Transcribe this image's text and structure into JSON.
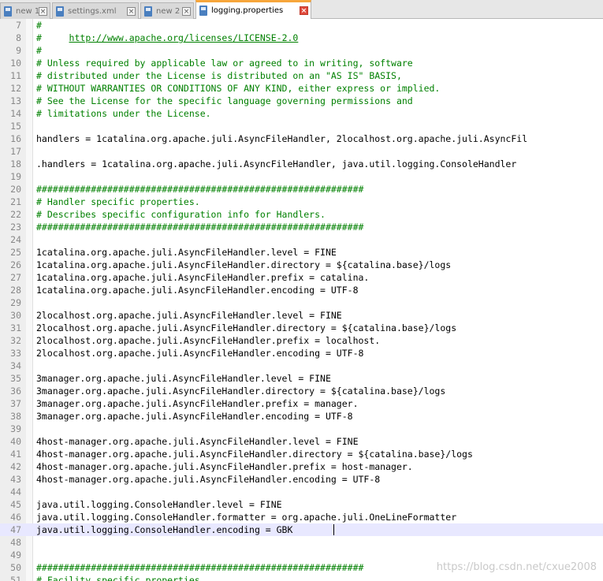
{
  "tabs": [
    {
      "label": "new 1",
      "active": false
    },
    {
      "label": "settings.xml",
      "active": false
    },
    {
      "label": "new 2",
      "active": false
    },
    {
      "label": "logging.properties",
      "active": true
    }
  ],
  "tab_close_glyph": "×",
  "lines": [
    {
      "num": "7",
      "text": "#",
      "type": "comment"
    },
    {
      "num": "8",
      "text": "#     ",
      "url": "http://www.apache.org/licenses/LICENSE-2.0",
      "type": "comment"
    },
    {
      "num": "9",
      "text": "#",
      "type": "comment"
    },
    {
      "num": "10",
      "text": "# Unless required by applicable law or agreed to in writing, software",
      "type": "comment"
    },
    {
      "num": "11",
      "text": "# distributed under the License is distributed on an \"AS IS\" BASIS,",
      "type": "comment"
    },
    {
      "num": "12",
      "text": "# WITHOUT WARRANTIES OR CONDITIONS OF ANY KIND, either express or implied.",
      "type": "comment"
    },
    {
      "num": "13",
      "text": "# See the License for the specific language governing permissions and",
      "type": "comment"
    },
    {
      "num": "14",
      "text": "# limitations under the License.",
      "type": "comment"
    },
    {
      "num": "15",
      "text": "",
      "type": "code"
    },
    {
      "num": "16",
      "text": "handlers = 1catalina.org.apache.juli.AsyncFileHandler, 2localhost.org.apache.juli.AsyncFil",
      "type": "code"
    },
    {
      "num": "17",
      "text": "",
      "type": "code"
    },
    {
      "num": "18",
      "text": ".handlers = 1catalina.org.apache.juli.AsyncFileHandler, java.util.logging.ConsoleHandler",
      "type": "code"
    },
    {
      "num": "19",
      "text": "",
      "type": "code"
    },
    {
      "num": "20",
      "text": "############################################################",
      "type": "comment"
    },
    {
      "num": "21",
      "text": "# Handler specific properties.",
      "type": "comment"
    },
    {
      "num": "22",
      "text": "# Describes specific configuration info for Handlers.",
      "type": "comment"
    },
    {
      "num": "23",
      "text": "############################################################",
      "type": "comment"
    },
    {
      "num": "24",
      "text": "",
      "type": "code"
    },
    {
      "num": "25",
      "text": "1catalina.org.apache.juli.AsyncFileHandler.level = FINE",
      "type": "code"
    },
    {
      "num": "26",
      "text": "1catalina.org.apache.juli.AsyncFileHandler.directory = ${catalina.base}/logs",
      "type": "code"
    },
    {
      "num": "27",
      "text": "1catalina.org.apache.juli.AsyncFileHandler.prefix = catalina.",
      "type": "code"
    },
    {
      "num": "28",
      "text": "1catalina.org.apache.juli.AsyncFileHandler.encoding = UTF-8",
      "type": "code"
    },
    {
      "num": "29",
      "text": "",
      "type": "code"
    },
    {
      "num": "30",
      "text": "2localhost.org.apache.juli.AsyncFileHandler.level = FINE",
      "type": "code"
    },
    {
      "num": "31",
      "text": "2localhost.org.apache.juli.AsyncFileHandler.directory = ${catalina.base}/logs",
      "type": "code"
    },
    {
      "num": "32",
      "text": "2localhost.org.apache.juli.AsyncFileHandler.prefix = localhost.",
      "type": "code"
    },
    {
      "num": "33",
      "text": "2localhost.org.apache.juli.AsyncFileHandler.encoding = UTF-8",
      "type": "code"
    },
    {
      "num": "34",
      "text": "",
      "type": "code"
    },
    {
      "num": "35",
      "text": "3manager.org.apache.juli.AsyncFileHandler.level = FINE",
      "type": "code"
    },
    {
      "num": "36",
      "text": "3manager.org.apache.juli.AsyncFileHandler.directory = ${catalina.base}/logs",
      "type": "code"
    },
    {
      "num": "37",
      "text": "3manager.org.apache.juli.AsyncFileHandler.prefix = manager.",
      "type": "code"
    },
    {
      "num": "38",
      "text": "3manager.org.apache.juli.AsyncFileHandler.encoding = UTF-8",
      "type": "code"
    },
    {
      "num": "39",
      "text": "",
      "type": "code"
    },
    {
      "num": "40",
      "text": "4host-manager.org.apache.juli.AsyncFileHandler.level = FINE",
      "type": "code"
    },
    {
      "num": "41",
      "text": "4host-manager.org.apache.juli.AsyncFileHandler.directory = ${catalina.base}/logs",
      "type": "code"
    },
    {
      "num": "42",
      "text": "4host-manager.org.apache.juli.AsyncFileHandler.prefix = host-manager.",
      "type": "code"
    },
    {
      "num": "43",
      "text": "4host-manager.org.apache.juli.AsyncFileHandler.encoding = UTF-8",
      "type": "code"
    },
    {
      "num": "44",
      "text": "",
      "type": "code"
    },
    {
      "num": "45",
      "text": "java.util.logging.ConsoleHandler.level = FINE",
      "type": "code"
    },
    {
      "num": "46",
      "text": "java.util.logging.ConsoleHandler.formatter = org.apache.juli.OneLineFormatter",
      "type": "code"
    },
    {
      "num": "47",
      "text": "java.util.logging.ConsoleHandler.encoding = GBK",
      "type": "code",
      "current": true
    },
    {
      "num": "48",
      "text": "",
      "type": "code"
    },
    {
      "num": "49",
      "text": "",
      "type": "code"
    },
    {
      "num": "50",
      "text": "############################################################",
      "type": "comment"
    },
    {
      "num": "51",
      "text": "# Facility specific properties.",
      "type": "comment"
    }
  ],
  "watermark": "https://blog.csdn.net/cxue2008"
}
